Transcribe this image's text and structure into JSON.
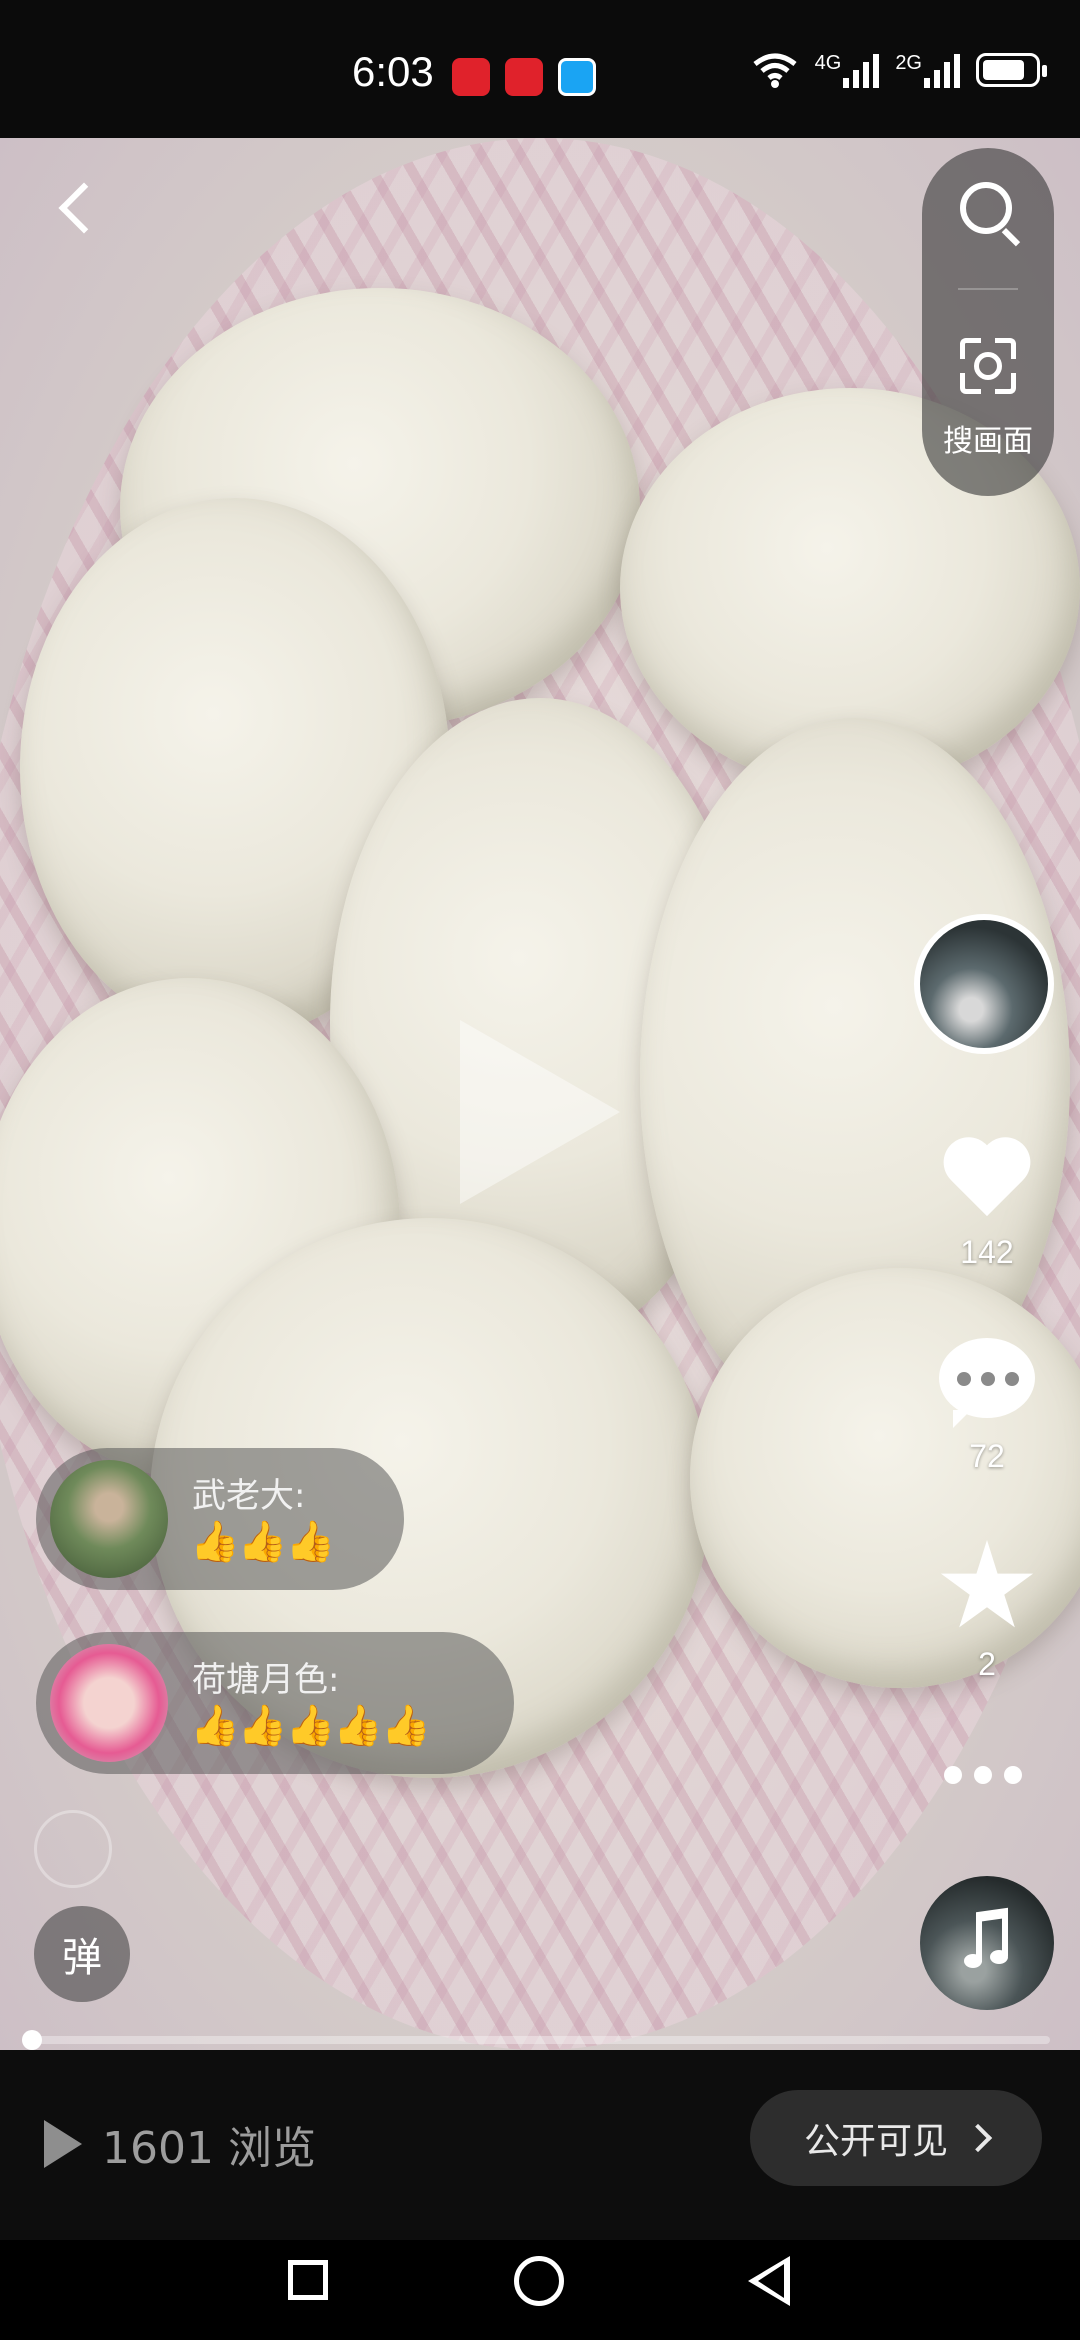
{
  "status_bar": {
    "time": "6:03",
    "network_1": "4G",
    "network_2": "2G"
  },
  "top": {
    "scan_label": "搜画面"
  },
  "actions": {
    "likes": "142",
    "comments": "72",
    "favorites": "2"
  },
  "comments": [
    {
      "name": "武老大:",
      "emoji": "👍👍👍"
    },
    {
      "name": "荷塘月色:",
      "emoji": "👍👍👍👍👍"
    }
  ],
  "danmu_label": "弹",
  "bottom": {
    "views": "1601 浏览",
    "visibility": "公开可见"
  }
}
